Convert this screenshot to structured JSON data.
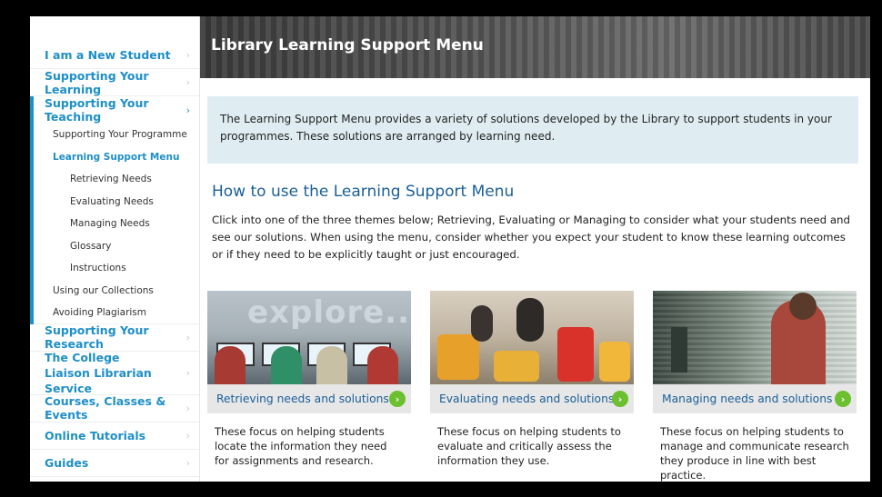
{
  "sidebar": {
    "items_top": [
      {
        "label": "I am a New Student"
      },
      {
        "label": "Supporting Your Learning"
      }
    ],
    "group": {
      "label": "Supporting Your Teaching",
      "chevron": "›",
      "subitems": [
        {
          "label": "Supporting Your Programme"
        },
        {
          "label": "Learning Support Menu"
        },
        {
          "label": "Retrieving Needs"
        },
        {
          "label": "Evaluating Needs"
        },
        {
          "label": "Managing Needs"
        },
        {
          "label": "Glossary"
        },
        {
          "label": "Instructions"
        },
        {
          "label": "Using our Collections"
        },
        {
          "label": "Avoiding Plagiarism"
        }
      ]
    },
    "items_bottom": [
      {
        "label": "Supporting Your Research"
      },
      {
        "label": "The College Liaison Librarian Service"
      },
      {
        "label": "Courses, Classes & Events"
      },
      {
        "label": "Online Tutorials"
      },
      {
        "label": "Guides"
      }
    ],
    "chevron": "›"
  },
  "banner": {
    "title": "Library Learning Support Menu"
  },
  "intro": {
    "text": "The Learning Support Menu provides a variety of solutions developed by the Library to support students in your programmes. These solutions are arranged by learning need."
  },
  "howto": {
    "heading": "How to use the Learning Support Menu",
    "text": "Click into one of the three themes below; Retrieving, Evaluating or Managing to consider what your students need and see our solutions. When using the menu, consider whether you expect your student to know these learning outcomes or if they need to be explicitly taught or just encouraged."
  },
  "cards": [
    {
      "title": "Retrieving needs and solutions",
      "image_word": "explore...",
      "desc": "These focus on helping students locate the information they need for assignments and research."
    },
    {
      "title": "Evaluating needs and solutions",
      "desc": "These focus on helping students to evaluate and critically assess the information they use."
    },
    {
      "title": "Managing needs and solutions",
      "desc": "These focus on helping students to manage and communicate research they produce in line with best practice."
    }
  ],
  "icons": {
    "go": "›"
  },
  "colors": {
    "link": "#1e8fc7",
    "heading": "#1a5f98",
    "intro_bg": "#dfedf3",
    "go": "#6cbf2f"
  }
}
